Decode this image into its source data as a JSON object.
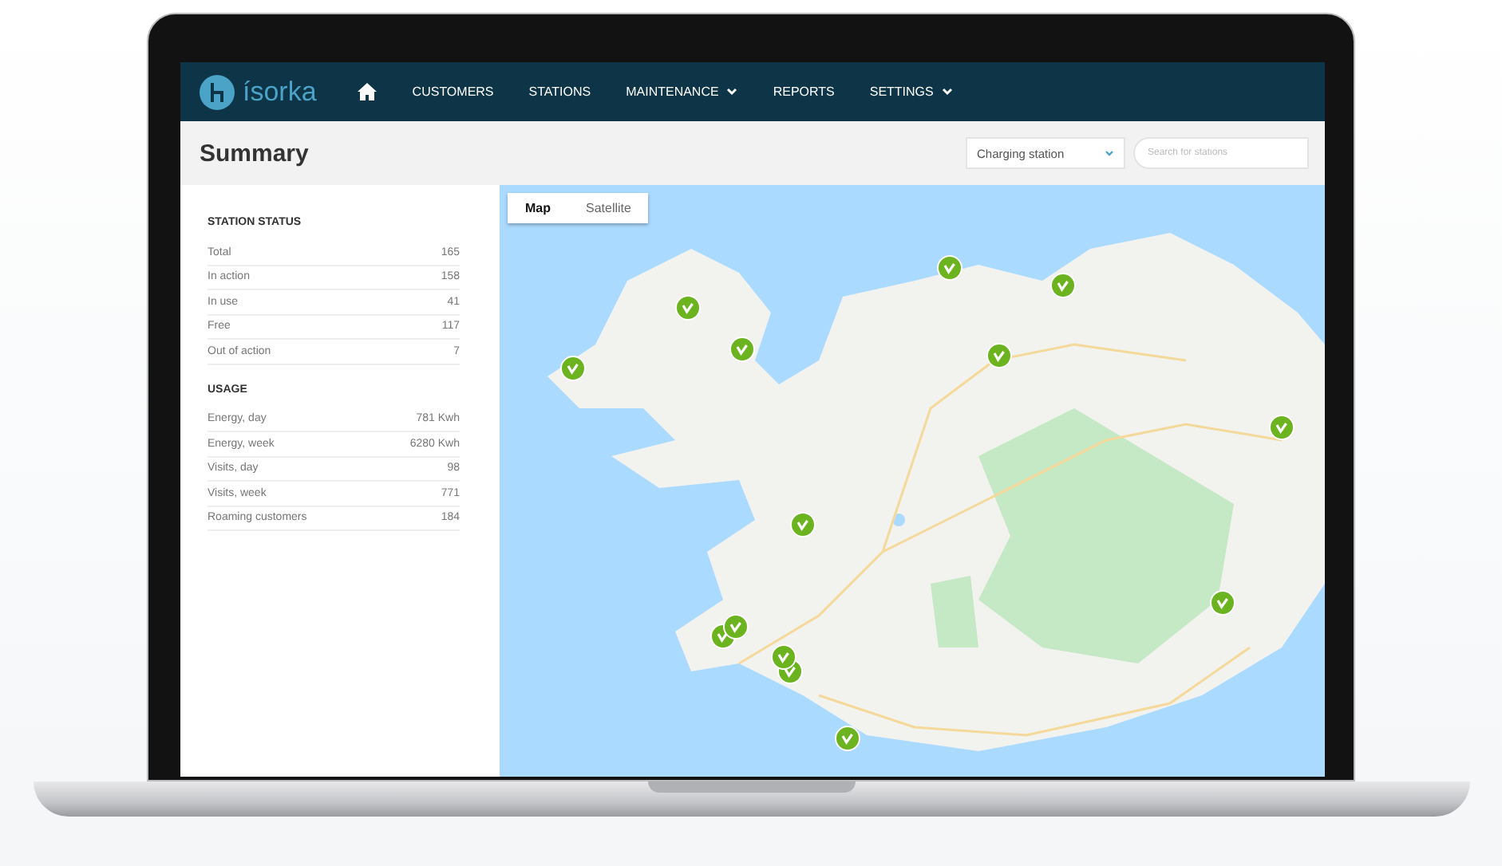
{
  "brand": "ísorka",
  "nav": [
    {
      "label": "CUSTOMERS",
      "has_menu": false
    },
    {
      "label": "STATIONS",
      "has_menu": false
    },
    {
      "label": "MAINTENANCE",
      "has_menu": true
    },
    {
      "label": "REPORTS",
      "has_menu": false
    },
    {
      "label": "SETTINGS",
      "has_menu": true
    }
  ],
  "page_title": "Summary",
  "station_select": {
    "value": "Charging station"
  },
  "search": {
    "placeholder": "Search for stations"
  },
  "sections": [
    {
      "title": "STATION STATUS",
      "rows": [
        {
          "label": "Total",
          "value": "165"
        },
        {
          "label": "In action",
          "value": "158"
        },
        {
          "label": "In use",
          "value": "41"
        },
        {
          "label": "Free",
          "value": "117"
        },
        {
          "label": "Out of action",
          "value": "7"
        }
      ]
    },
    {
      "title": "USAGE",
      "rows": [
        {
          "label": "Energy, day",
          "value": "781 Kwh"
        },
        {
          "label": "Energy, week",
          "value": "6280 Kwh"
        },
        {
          "label": "Visits, day",
          "value": "98"
        },
        {
          "label": "Visits, week",
          "value": "771"
        },
        {
          "label": "Roaming customers",
          "value": "184"
        }
      ]
    }
  ],
  "map": {
    "kind": "picture",
    "tabs": [
      {
        "label": "Map",
        "selected": true
      },
      {
        "label": "Satellite",
        "selected": false
      }
    ]
  }
}
